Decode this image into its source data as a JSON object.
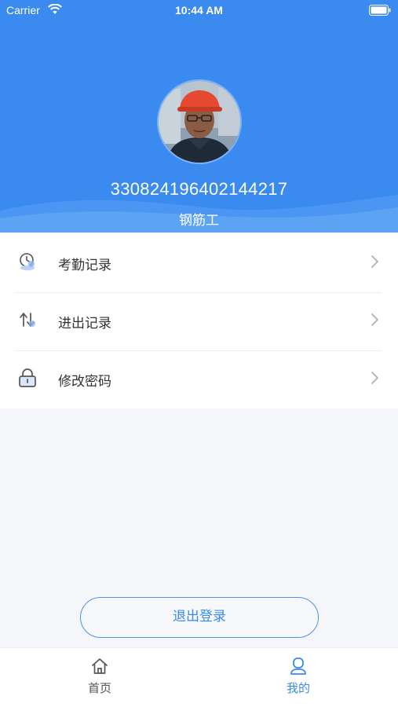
{
  "status_bar": {
    "carrier": "Carrier",
    "time": "10:44 AM"
  },
  "profile": {
    "id_number": "330824196402144217",
    "role": "钢筋工"
  },
  "menu": {
    "items": [
      {
        "label": "考勤记录",
        "icon": "clock-icon"
      },
      {
        "label": "进出记录",
        "icon": "exchange-icon"
      },
      {
        "label": "修改密码",
        "icon": "lock-icon"
      }
    ]
  },
  "logout_label": "退出登录",
  "tabbar": {
    "tabs": [
      {
        "label": "首页",
        "icon": "home-icon",
        "active": false
      },
      {
        "label": "我的",
        "icon": "person-icon",
        "active": true
      }
    ]
  },
  "colors": {
    "primary": "#3a8af0",
    "background": "#f4f6fa",
    "text": "#333333"
  }
}
